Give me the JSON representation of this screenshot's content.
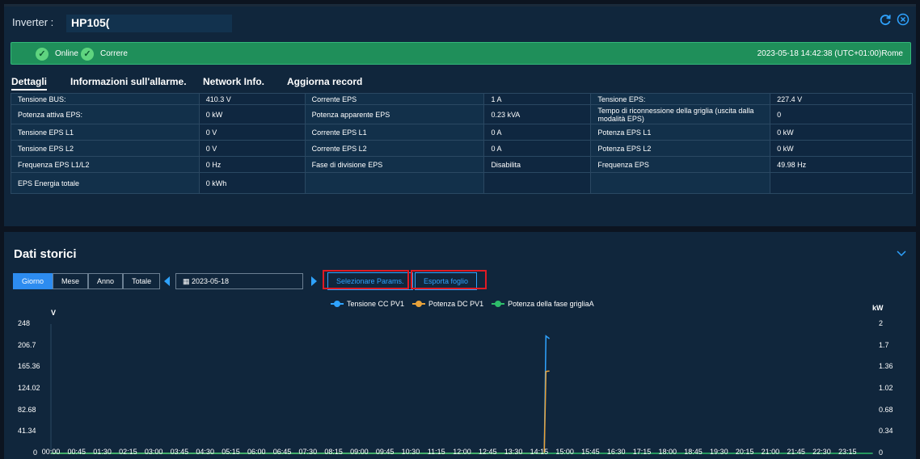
{
  "header": {
    "label": "Inverter :",
    "value": "HP105(",
    "refresh_icon": "refresh-icon",
    "close_icon": "close-circle-icon"
  },
  "status": {
    "items": [
      "Online",
      "Correre"
    ],
    "timestamp": "2023-05-18 14:42:38 (UTC+01:00)Rome"
  },
  "tabs": [
    {
      "label": "Dettagli"
    },
    {
      "label": "Informazioni sull'allarme."
    },
    {
      "label": "Network Info."
    },
    {
      "label": "Aggiorna record"
    }
  ],
  "table": {
    "rows": [
      [
        "Tensione BUS:",
        "410.3 V",
        "Corrente EPS",
        "1 A",
        "Tensione EPS:",
        "227.4 V"
      ],
      [
        "Potenza attiva EPS:",
        "0 kW",
        "Potenza apparente EPS",
        "0.23 kVA",
        "Tempo di riconnessione della griglia (uscita dalla modalità EPS)",
        "0"
      ],
      [
        "Tensione EPS L1",
        "0 V",
        "Corrente EPS L1",
        "0 A",
        "Potenza EPS L1",
        "0 kW"
      ],
      [
        "Tensione EPS L2",
        "0 V",
        "Corrente EPS L2",
        "0 A",
        "Potenza EPS L2",
        "0 kW"
      ],
      [
        "Frequenza EPS L1/L2",
        "0 Hz",
        "Fase di divisione EPS",
        "Disabilita",
        "Frequenza EPS",
        "49.98 Hz"
      ],
      [
        "EPS Energia totale",
        "0 kWh",
        "",
        "",
        "",
        ""
      ]
    ]
  },
  "history": {
    "title": "Dati storici",
    "periods": [
      "Giorno",
      "Mese",
      "Anno",
      "Totale"
    ],
    "active_period": "Giorno",
    "date": "2023-05-18",
    "select_params": "Selezionare Params.",
    "export_sheet": "Esporta foglio"
  },
  "chart_data": {
    "type": "line",
    "y_left_unit": "V",
    "y_right_unit": "kW",
    "y_left_ticks": [
      "248",
      "206.7",
      "165.36",
      "124.02",
      "82.68",
      "41.34",
      "0"
    ],
    "y_right_ticks": [
      "2",
      "1.7",
      "1.36",
      "1.02",
      "0.68",
      "0.34",
      "0"
    ],
    "ylim_left": [
      0,
      248
    ],
    "ylim_right": [
      0,
      2
    ],
    "x_ticks": [
      "00:00",
      "00:45",
      "01:30",
      "02:15",
      "03:00",
      "03:45",
      "04:30",
      "05:15",
      "06:00",
      "06:45",
      "07:30",
      "08:15",
      "09:00",
      "09:45",
      "10:30",
      "11:15",
      "12:00",
      "12:45",
      "13:30",
      "14:15",
      "15:00",
      "15:45",
      "16:30",
      "17:15",
      "18:00",
      "18:45",
      "19:30",
      "20:15",
      "21:00",
      "21:45",
      "22:30",
      "23:15"
    ],
    "legend_position": "top",
    "series": [
      {
        "name": "Tensione CC PV1",
        "color": "#2fa3ff",
        "axis": "left",
        "points": [
          [
            "00:00",
            0
          ],
          [
            "14:24",
            0
          ],
          [
            "14:27",
            225
          ],
          [
            "14:33",
            220
          ]
        ]
      },
      {
        "name": "Potenza DC PV1",
        "color": "#e8a23a",
        "axis": "left",
        "points": [
          [
            "00:00",
            0
          ],
          [
            "14:24",
            0
          ],
          [
            "14:27",
            157
          ],
          [
            "14:33",
            158
          ]
        ]
      },
      {
        "name": "Potenza della fase grigliaA",
        "color": "#2ebd6a",
        "axis": "right",
        "points": [
          [
            "00:00",
            0
          ],
          [
            "23:59",
            0
          ]
        ]
      }
    ]
  }
}
